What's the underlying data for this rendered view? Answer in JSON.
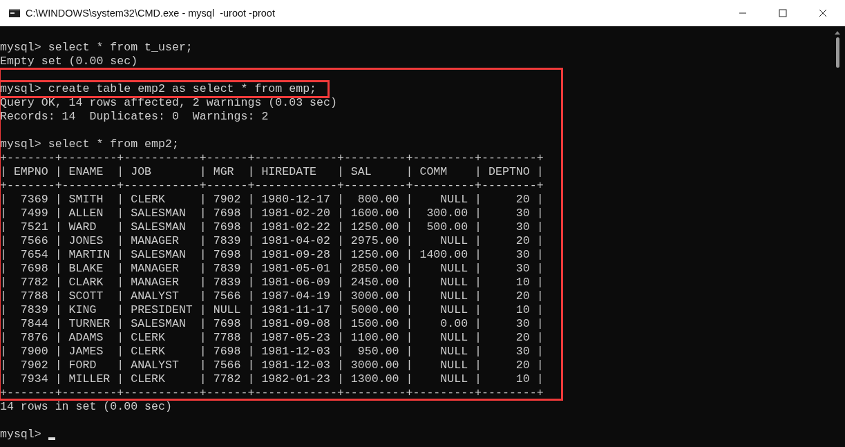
{
  "window": {
    "title": "C:\\WINDOWS\\system32\\CMD.exe - mysql  -uroot -proot"
  },
  "console": {
    "blocks_before": [
      [
        "mysql> select * from t_user;",
        "Empty set (0.00 sec)"
      ]
    ],
    "highlight": {
      "marked_line": "mysql> create table emp2 as select * from emp;",
      "blocks": [
        [
          "Query OK, 14 rows affected, 2 warnings (0.03 sec)",
          "Records: 14  Duplicates: 0  Warnings: 2"
        ],
        [
          "mysql> select * from emp2;",
          "+-------+--------+-----------+------+------------+---------+---------+--------+",
          "| EMPNO | ENAME  | JOB       | MGR  | HIREDATE   | SAL     | COMM    | DEPTNO |",
          "+-------+--------+-----------+------+------------+---------+---------+--------+",
          "|  7369 | SMITH  | CLERK     | 7902 | 1980-12-17 |  800.00 |    NULL |     20 |",
          "|  7499 | ALLEN  | SALESMAN  | 7698 | 1981-02-20 | 1600.00 |  300.00 |     30 |",
          "|  7521 | WARD   | SALESMAN  | 7698 | 1981-02-22 | 1250.00 |  500.00 |     30 |",
          "|  7566 | JONES  | MANAGER   | 7839 | 1981-04-02 | 2975.00 |    NULL |     20 |",
          "|  7654 | MARTIN | SALESMAN  | 7698 | 1981-09-28 | 1250.00 | 1400.00 |     30 |",
          "|  7698 | BLAKE  | MANAGER   | 7839 | 1981-05-01 | 2850.00 |    NULL |     30 |",
          "|  7782 | CLARK  | MANAGER   | 7839 | 1981-06-09 | 2450.00 |    NULL |     10 |",
          "|  7788 | SCOTT  | ANALYST   | 7566 | 1987-04-19 | 3000.00 |    NULL |     20 |",
          "|  7839 | KING   | PRESIDENT | NULL | 1981-11-17 | 5000.00 |    NULL |     10 |",
          "|  7844 | TURNER | SALESMAN  | 7698 | 1981-09-08 | 1500.00 |    0.00 |     30 |",
          "|  7876 | ADAMS  | CLERK     | 7788 | 1987-05-23 | 1100.00 |    NULL |     20 |",
          "|  7900 | JAMES  | CLERK     | 7698 | 1981-12-03 |  950.00 |    NULL |     30 |",
          "|  7902 | FORD   | ANALYST   | 7566 | 1981-12-03 | 3000.00 |    NULL |     20 |",
          "|  7934 | MILLER | CLERK     | 7782 | 1982-01-23 | 1300.00 |    NULL |     10 |",
          "+-------+--------+-----------+------+------------+---------+---------+--------+"
        ]
      ]
    },
    "blocks_after": [
      [
        "14 rows in set (0.00 sec)"
      ]
    ],
    "prompt": "mysql>",
    "cursor_visible": true
  }
}
